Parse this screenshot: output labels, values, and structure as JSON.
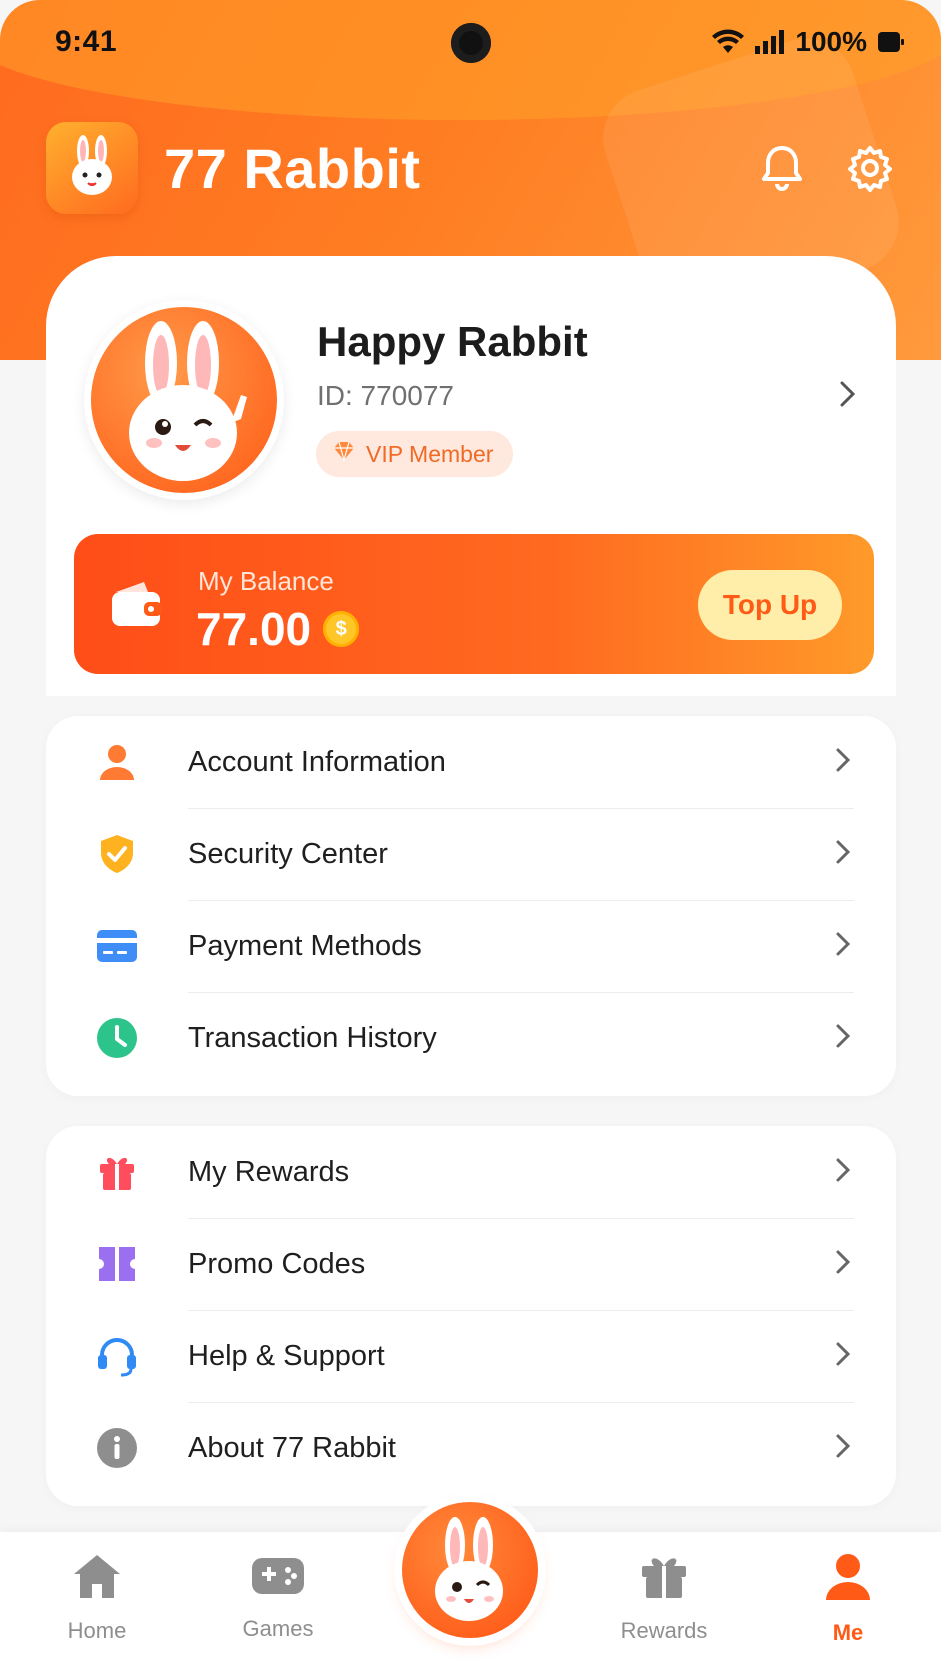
{
  "status_bar": {
    "time": "9:41",
    "battery": "100%"
  },
  "header": {
    "title": "77 Rabbit"
  },
  "profile": {
    "name": "Happy Rabbit",
    "id_text": "ID: 770077",
    "badge": "VIP Member"
  },
  "balance": {
    "label": "My Balance",
    "amount": "77.00",
    "coin_symbol": "$",
    "top_up": "Top Up"
  },
  "menu_group_1": [
    {
      "label": "Account Information",
      "icon": "user-icon",
      "color": "#ff7a33"
    },
    {
      "label": "Security Center",
      "icon": "shield-check-icon",
      "color": "#ffb21f"
    },
    {
      "label": "Payment Methods",
      "icon": "card-icon",
      "color": "#3f8df7"
    },
    {
      "label": "Transaction History",
      "icon": "clock-icon",
      "color": "#2cc48a"
    }
  ],
  "menu_group_2": [
    {
      "label": "My Rewards",
      "icon": "gift-icon",
      "color": "#ff4d5e"
    },
    {
      "label": "Promo Codes",
      "icon": "ticket-icon",
      "color": "#9a6ff0"
    },
    {
      "label": "Help & Support",
      "icon": "headset-icon",
      "color": "#2f8af5"
    },
    {
      "label": "About 77 Rabbit",
      "icon": "info-icon",
      "color": "#8e8e8e"
    }
  ],
  "bottom_nav": [
    {
      "label": "Home",
      "icon": "home-icon",
      "active": false
    },
    {
      "label": "Games",
      "icon": "gamepad-icon",
      "active": false
    },
    {
      "label": "",
      "icon": "rabbit-center-icon",
      "active": false
    },
    {
      "label": "Rewards",
      "icon": "gift-icon",
      "active": false
    },
    {
      "label": "Me",
      "icon": "person-icon",
      "active": true
    }
  ],
  "colors": {
    "accent": "#ff5a16",
    "accent_light": "#ff9a3c",
    "topup_bg": "#ffeeaa"
  }
}
